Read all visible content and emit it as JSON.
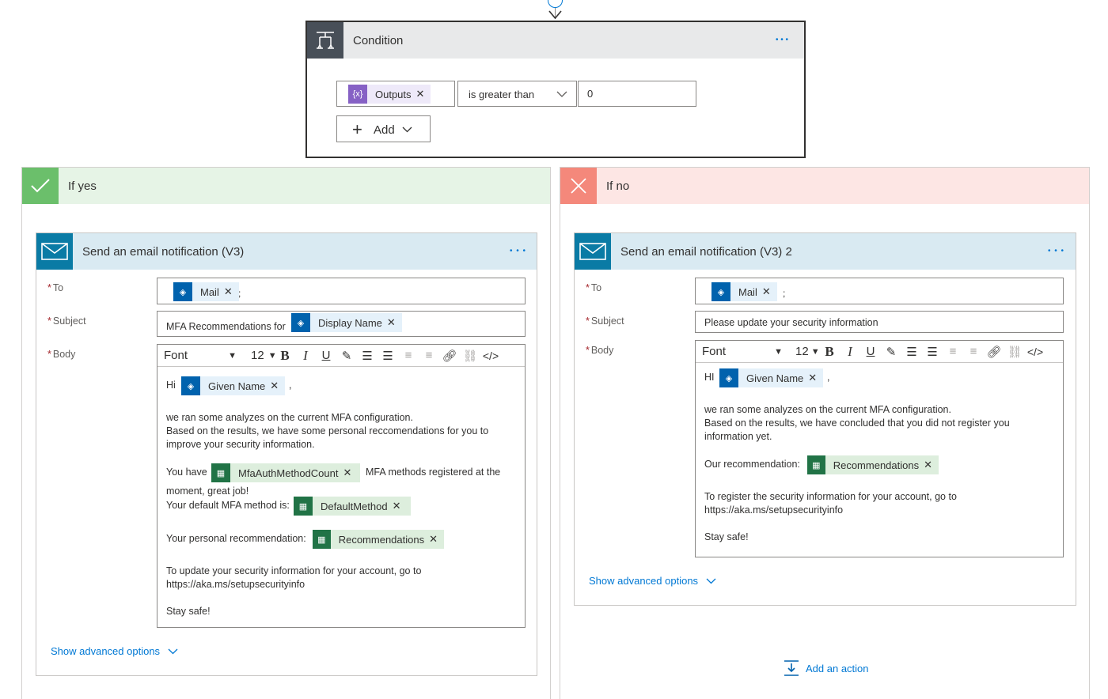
{
  "condition": {
    "title": "Condition",
    "more": "• • •",
    "left_token": "Outputs",
    "operator": "is greater than",
    "value": "0",
    "add_label": "Add"
  },
  "yes_branch": {
    "title": "If yes",
    "action": {
      "title": "Send an email notification (V3)",
      "more": "• • •",
      "to_label": "To",
      "to_token": "Mail",
      "to_sep": ";",
      "subject_label": "Subject",
      "subject_prefix": "MFA Recommendations for",
      "subject_token": "Display Name",
      "body_label": "Body",
      "toolbar": {
        "font": "Font",
        "size": "12"
      },
      "body": {
        "greeting": "Hi",
        "greeting_token": "Given Name",
        "greeting_tail": ",",
        "para1_line1": "we ran some analyzes on the current MFA configuration.",
        "para1_line2": "Based on the results, we have some personal reccomendations for you to",
        "para1_line3": "improve your security information.",
        "you_have": "You have",
        "count_token": "MfaAuthMethodCount",
        "methods_tail": "MFA methods registered at the",
        "moment": "moment, great job!",
        "default_label": "Your default MFA method is:",
        "default_token": "DefaultMethod",
        "personal_label": "Your personal recommendation:",
        "recommend_token": "Recommendations",
        "update_line1": "To update your security information for your account, go to",
        "update_line2": "https://aka.ms/setupsecurityinfo",
        "closing": "Stay safe!"
      },
      "advanced": "Show advanced options"
    }
  },
  "no_branch": {
    "title": "If no",
    "action": {
      "title": "Send an email notification (V3) 2",
      "more": "• • •",
      "to_label": "To",
      "to_token": "Mail",
      "to_sep": ";",
      "subject_label": "Subject",
      "subject_value": "Please update your security information",
      "body_label": "Body",
      "toolbar": {
        "font": "Font",
        "size": "12"
      },
      "body": {
        "greeting": "HI",
        "greeting_token": "Given Name",
        "greeting_tail": ",",
        "para1_line1": "we ran some analyzes on the current MFA configuration.",
        "para1_line2": "Based on the results, we have concluded that you did not register you",
        "para1_line3": "information yet.",
        "recommend_label": "Our recommendation:",
        "recommend_token": "Recommendations",
        "register_line1": "To register the security information for your account, go to",
        "register_line2": "https://aka.ms/setupsecurityinfo",
        "closing": "Stay safe!"
      },
      "advanced": "Show advanced options"
    },
    "add_action": "Add an action"
  },
  "colors": {
    "accent": "#0078d4",
    "yes_head": "#e6f4e6",
    "yes_icon": "#6bbf6b",
    "no_head": "#fde6e4",
    "no_icon": "#f4887b",
    "email_icon": "#0a7ba5",
    "azure_icon": "#0062ad",
    "excel_icon": "#217346"
  }
}
